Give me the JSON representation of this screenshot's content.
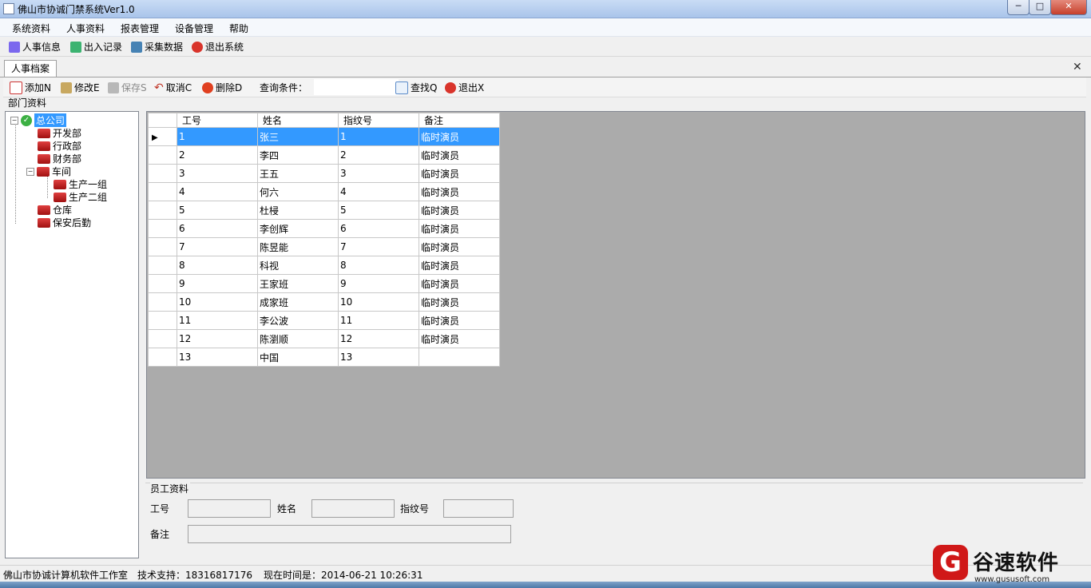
{
  "window": {
    "title": "佛山市协诚门禁系统Ver1.0",
    "min": "─",
    "max": "□",
    "close": "✕"
  },
  "menu": [
    "系统资料",
    "人事资料",
    "报表管理",
    "设备管理",
    "帮助"
  ],
  "toolbar": [
    {
      "label": "人事信息",
      "icon": "users-icon",
      "color": "#6a5acd"
    },
    {
      "label": "出入记录",
      "icon": "pencil-icon",
      "color": "#2e8b57"
    },
    {
      "label": "采集数据",
      "icon": "database-icon",
      "color": "#4682b4"
    },
    {
      "label": "退出系统",
      "icon": "exit-icon",
      "color": "#d9342b"
    }
  ],
  "doc_tab": {
    "label": "人事档案",
    "close": "✕"
  },
  "inner_toolbar": {
    "add": "添加N",
    "edit": "修改E",
    "save": "保存S",
    "cancel": "取消C",
    "delete": "删除D",
    "query_label": "查询条件：",
    "search_value": "",
    "find": "查找Q",
    "exit": "退出X"
  },
  "dept": {
    "title": "部门资料",
    "root": "总公司",
    "nodes": [
      "开发部",
      "行政部",
      "财务部",
      "车间",
      "生产一组",
      "生产二组",
      "仓库",
      "保安后勤"
    ]
  },
  "grid": {
    "columns": [
      "工号",
      "姓名",
      "指纹号",
      "备注"
    ],
    "rows": [
      [
        "1",
        "张三",
        "1",
        "临时演员"
      ],
      [
        "2",
        "李四",
        "2",
        "临时演员"
      ],
      [
        "3",
        "王五",
        "3",
        "临时演员"
      ],
      [
        "4",
        "何六",
        "4",
        "临时演员"
      ],
      [
        "5",
        "杜梫",
        "5",
        "临时演员"
      ],
      [
        "6",
        "李创辉",
        "6",
        "临时演员"
      ],
      [
        "7",
        "陈昱能",
        "7",
        "临时演员"
      ],
      [
        "8",
        "科视",
        "8",
        "临时演员"
      ],
      [
        "9",
        "王家班",
        "9",
        "临时演员"
      ],
      [
        "10",
        "成家班",
        "10",
        "临时演员"
      ],
      [
        "11",
        "李公波",
        "11",
        "临时演员"
      ],
      [
        "12",
        "陈瀏顺",
        "12",
        "临时演员"
      ],
      [
        "13",
        "中国",
        "13",
        ""
      ]
    ],
    "selected_row": 0,
    "colors": {
      "selection": "#3399ff",
      "background": "#ababab"
    }
  },
  "employee": {
    "title": "员工资料",
    "id_label": "工号",
    "name_label": "姓名",
    "fp_label": "指纹号",
    "note_label": "备注",
    "id_value": "",
    "name_value": "",
    "fp_value": "",
    "note_value": ""
  },
  "status": {
    "company": "佛山市协诚计算机软件工作室",
    "support": "技术支持：18316817176",
    "time": "现在时间是：2014-06-21 10:26:31"
  },
  "watermark": {
    "brand": "谷速软件",
    "url": "www.gususoft.com"
  }
}
